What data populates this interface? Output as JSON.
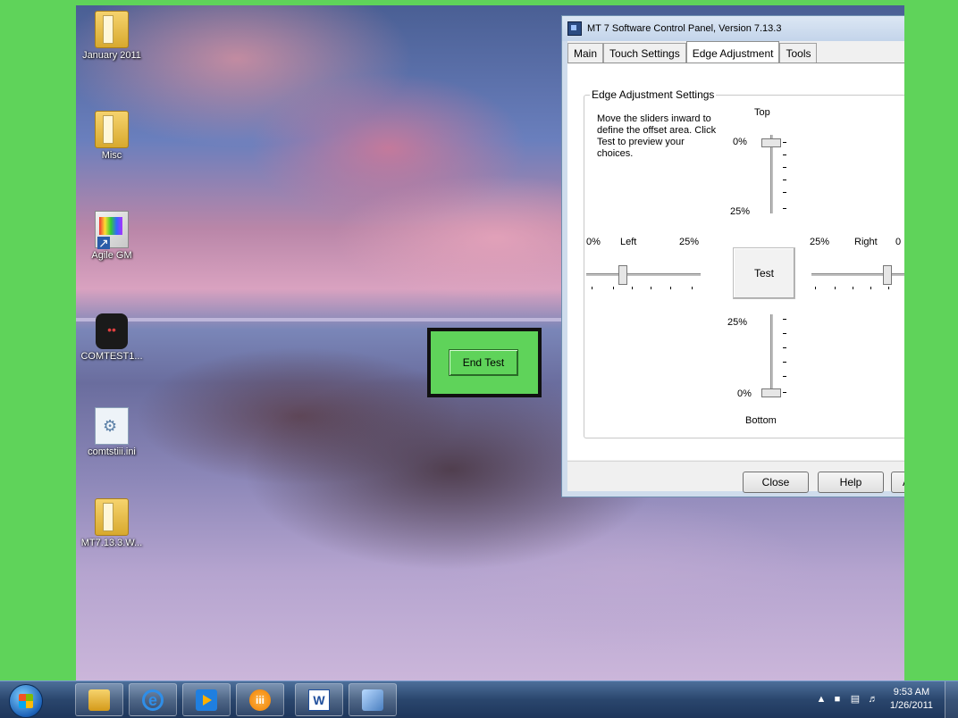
{
  "desktop": {
    "icons": [
      {
        "label": "January 2011"
      },
      {
        "label": "Misc"
      },
      {
        "label": "Agile GM"
      },
      {
        "label": "COMTEST1..."
      },
      {
        "label": "comtstiii.ini"
      },
      {
        "label": "MT7.13.3.W..."
      }
    ],
    "end_test_label": "End Test"
  },
  "window": {
    "title": "MT 7 Software Control Panel, Version 7.13.3",
    "tabs": [
      "Main",
      "Touch Settings",
      "Edge Adjustment",
      "Tools"
    ],
    "active_tab": "Edge Adjustment",
    "group_title": "Edge Adjustment Settings",
    "instructions": "Move the sliders inward to define the offset area. Click Test to preview your choices.",
    "top": {
      "label": "Top",
      "min": "0%",
      "max": "25%",
      "value_percent": 0
    },
    "left": {
      "label": "Left",
      "min": "0%",
      "max": "25%",
      "value_percent": 5
    },
    "right": {
      "label": "Right",
      "min": "0",
      "max": "25%",
      "value_percent": 5
    },
    "bottom": {
      "label": "Bottom",
      "min": "0%",
      "max": "25%",
      "value_percent": 0
    },
    "test_label": "Test",
    "buttons": {
      "close": "Close",
      "help": "Help",
      "apply": "A"
    }
  },
  "taskbar": {
    "clock_time": "9:53 AM",
    "clock_date": "1/26/2011",
    "tray_arrow": "▲",
    "items": [
      "Windows Explorer",
      "Internet Explorer",
      "Media Player",
      "Installer",
      "Microsoft Word",
      "Tool"
    ]
  }
}
